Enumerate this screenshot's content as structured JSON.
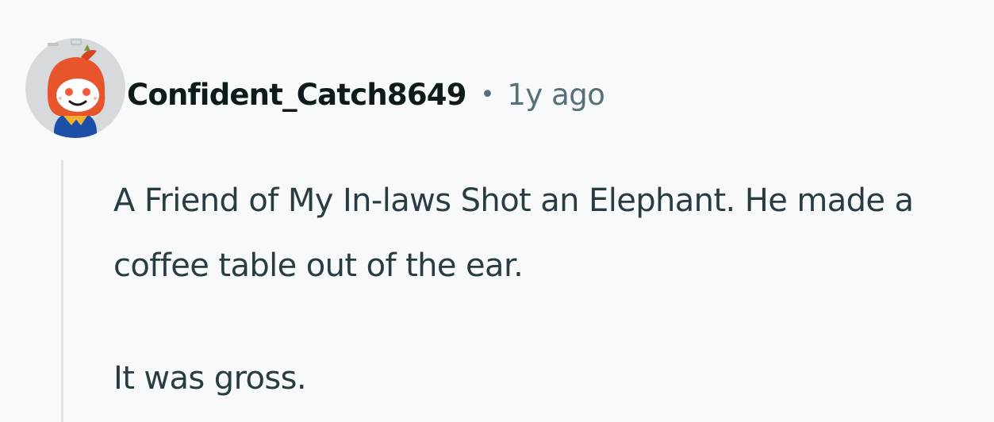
{
  "comment": {
    "author": "Confident_Catch8649",
    "separator": "•",
    "timestamp": "1y ago",
    "avatar_icon": "reddit-snoo-avatar-icon",
    "paragraphs": [
      "A Friend of My In-laws Shot an Elephant. He made a coffee table out of the ear.",
      "It was gross."
    ]
  },
  "colors": {
    "background": "#f8f9fb",
    "author": "#0f1a1c",
    "meta": "#576f76",
    "body": "#2a3c42",
    "thread_line": "#e0e4e7",
    "avatar_hood": "#e8542b",
    "avatar_bg": "#d6dadd"
  }
}
